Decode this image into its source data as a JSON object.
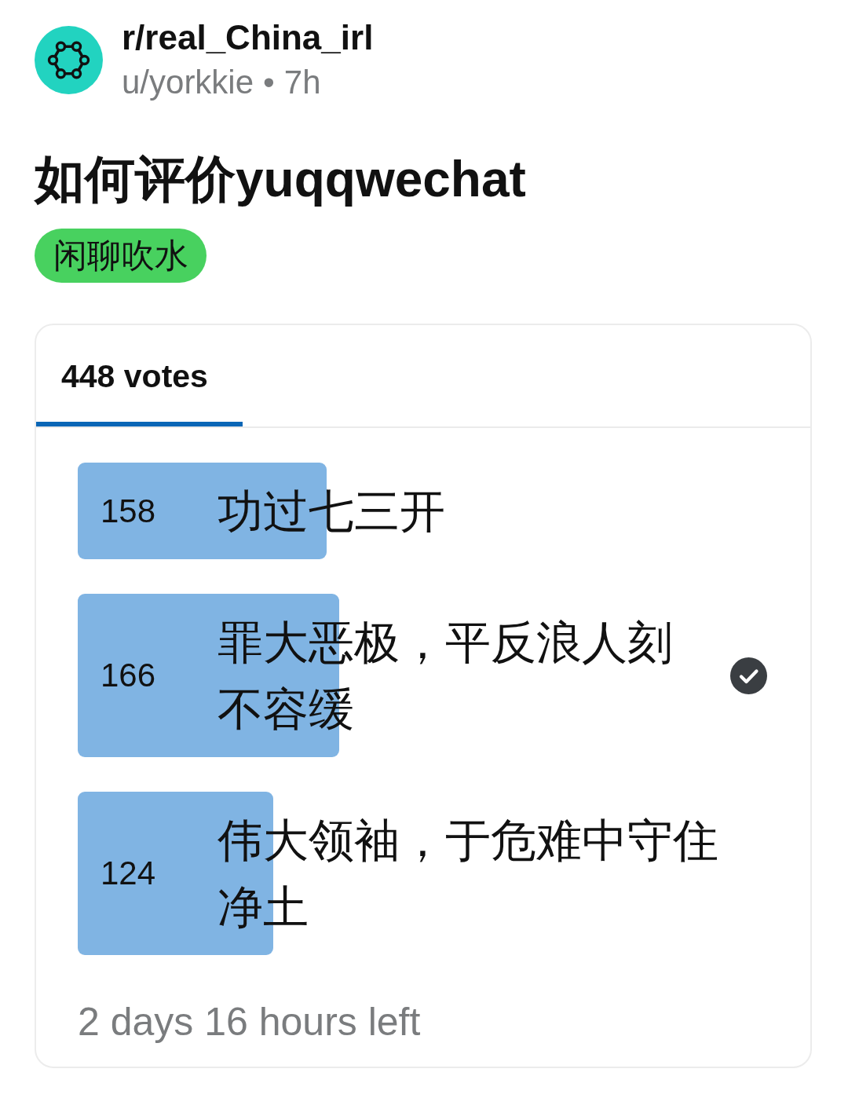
{
  "post": {
    "community": "r/real_China_irl",
    "author": "u/yorkkie",
    "separator": "•",
    "age": "7h",
    "title": "如何评价yuqqwechat",
    "flair": "闲聊吹水"
  },
  "poll": {
    "tabs": [
      {
        "label": "448 votes",
        "selected": true
      }
    ],
    "options": [
      {
        "votes": "158",
        "label": "功过七三开",
        "level": 0.353,
        "selected": false
      },
      {
        "votes": "166",
        "label": "罪大恶极，平反浪人刻不容缓",
        "level": 0.371,
        "selected": true
      },
      {
        "votes": "124",
        "label": "伟大领袖，于危难中守住净土",
        "level": 0.277,
        "selected": false
      }
    ],
    "time_left": "2 days 16 hours left"
  }
}
